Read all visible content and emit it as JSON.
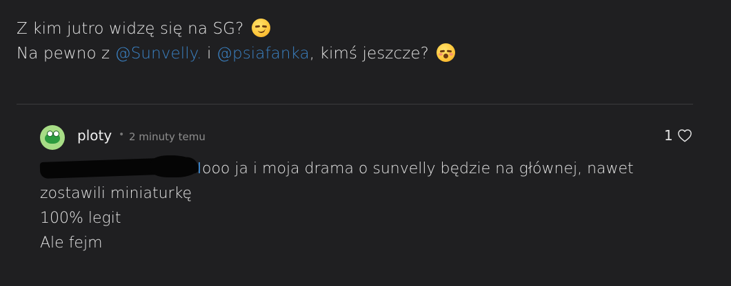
{
  "post": {
    "line1_text": "Z kim jutro widzę się na SG?",
    "line1_emoji": "smirking-face",
    "line2_prefix": "Na pewno z ",
    "mention1": "@Sunvelly.",
    "line2_mid": " i ",
    "mention2": "@psiafanka",
    "line2_suffix": ", kimś jeszcze?",
    "line2_emoji": "kissing-face-with-closed-eyes",
    "mention_color": "#3b82c4"
  },
  "comment": {
    "username": "ploty",
    "separator": "•",
    "timestamp": "2 minuty temu",
    "like_count": "1",
    "like_icon": "heart-outline-icon",
    "redacted_mention": "redacted-scribble",
    "text_line1": " ooo ja i moja drama o sunvelly będzie na głównej, nawet",
    "text_line2": "zostawili miniaturkę",
    "text_line3": "100% legit",
    "text_line4": "Ale fejm"
  },
  "colors": {
    "background": "#1f1f21",
    "text": "#e4e4e4",
    "muted": "#8e8e8e",
    "divider": "#3b3b3e",
    "avatar_bg": "#a7dd86"
  }
}
